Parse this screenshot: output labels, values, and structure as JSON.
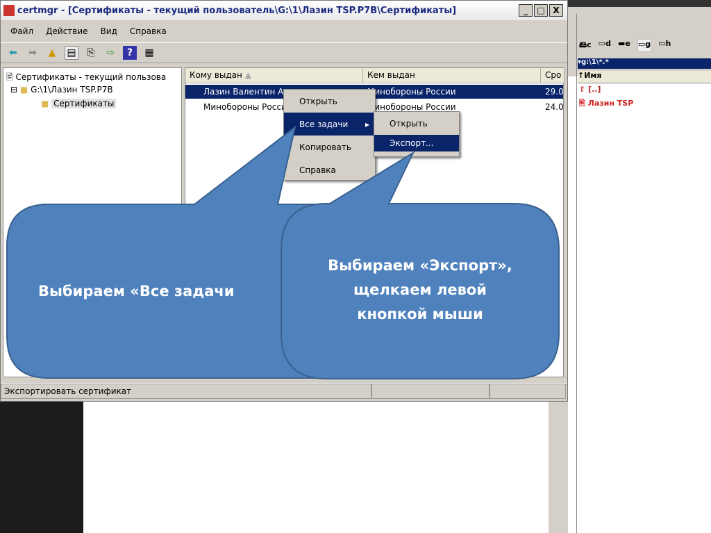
{
  "window": {
    "title": "certmgr - [Сертификаты - текущий пользователь\\G:\\1\\Лазин TSP.P7B\\Сертификаты]",
    "minimize": "_",
    "maximize": "□",
    "close": "X"
  },
  "menubar": [
    "Файл",
    "Действие",
    "Вид",
    "Справка"
  ],
  "toolbar_icons": [
    "back-icon",
    "forward-icon",
    "up-folder-icon",
    "show-tree-icon",
    "copy-icon",
    "export-icon",
    "help-icon",
    "properties-icon"
  ],
  "tree": {
    "root": "Сертификаты - текущий пользова",
    "store": "G:\\1\\Лазин TSP.P7B",
    "expander": "⊟",
    "folder": "Сертификаты"
  },
  "list": {
    "columns": [
      "Кому выдан",
      "Кем выдан",
      "Сро"
    ],
    "rows": [
      {
        "issued_to": "Лазин Валентин Александрович",
        "issued_by": "Минобороны России",
        "expires": "29.0"
      },
      {
        "issued_to": "Минобороны России",
        "issued_by": "Минобороны России",
        "expires": "24.0"
      }
    ]
  },
  "context_menu": [
    "Открыть",
    "Все задачи",
    "Копировать",
    "Справка"
  ],
  "submenu": [
    "Открыть",
    "Экспорт..."
  ],
  "status": "Экспортировать сертификат",
  "callouts": {
    "left": "Выбираем «Все задачи",
    "right": [
      "Выбираем «Экспорт»,",
      "щелкаем левой",
      "кнопкой мыши"
    ]
  },
  "file_manager": {
    "drives": [
      "c",
      "d",
      "e",
      "g",
      "h"
    ],
    "path": "▾g:\\1\\*.*",
    "header": "↑Имя",
    "items": [
      "[..]",
      "Лазин TSP"
    ]
  },
  "colors": {
    "callout": "#4f81bd",
    "selection": "#0a246a"
  }
}
